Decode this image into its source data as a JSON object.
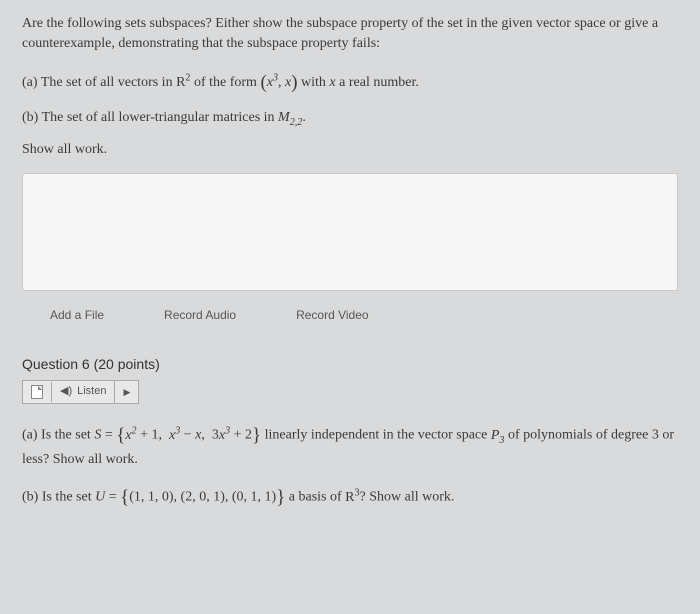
{
  "q5": {
    "intro": "Are the following sets subspaces? Either show the subspace property of the set in the given vector space or give a counterexample, demonstrating that the subspace property fails:",
    "part_a_pre": "(a) The set of all vectors in ",
    "R": "R",
    "R_sup": "2",
    "part_a_mid": " of the form ",
    "tuple_a": "x",
    "tuple_a_sup": "3",
    "tuple_sep": ", ",
    "tuple_b": "x",
    "part_a_post": " with ",
    "x": "x",
    "part_a_tail": " a real number.",
    "part_b_pre": "(b) The set of all lower-triangular matrices in ",
    "M": "M",
    "M_sub": "2,2",
    "period": ".",
    "show_work": "Show all work."
  },
  "toolbar": {
    "add_file": "Add a File",
    "record_audio": "Record Audio",
    "record_video": "Record Video"
  },
  "q6": {
    "header": "Question 6 (20 points)",
    "listen": "Listen",
    "part_a_pre": "(a) Is the set ",
    "S": "S",
    "equals": " = ",
    "s1a": "x",
    "s1a_sup": "2",
    "s1b": " + 1",
    "s2a": "x",
    "s2a_sup": "3",
    "s2b": " − ",
    "s2c": "x",
    "s3a": "3",
    "s3b": "x",
    "s3b_sup": "3",
    "s3c": " + 2",
    "part_a_mid": " linearly independent in the vector space ",
    "P": "P",
    "P_sub": "3",
    "part_a_post": " of polynomials of degree 3 or less? Show all work.",
    "part_b_pre": "(b) Is the set ",
    "U": "U",
    "u1": "(1, 1, 0)",
    "u2": "(2, 0, 1)",
    "u3": "(0, 1, 1)",
    "part_b_mid": " a basis of ",
    "R": "R",
    "R_sup": "3",
    "part_b_post": "? Show all work."
  }
}
